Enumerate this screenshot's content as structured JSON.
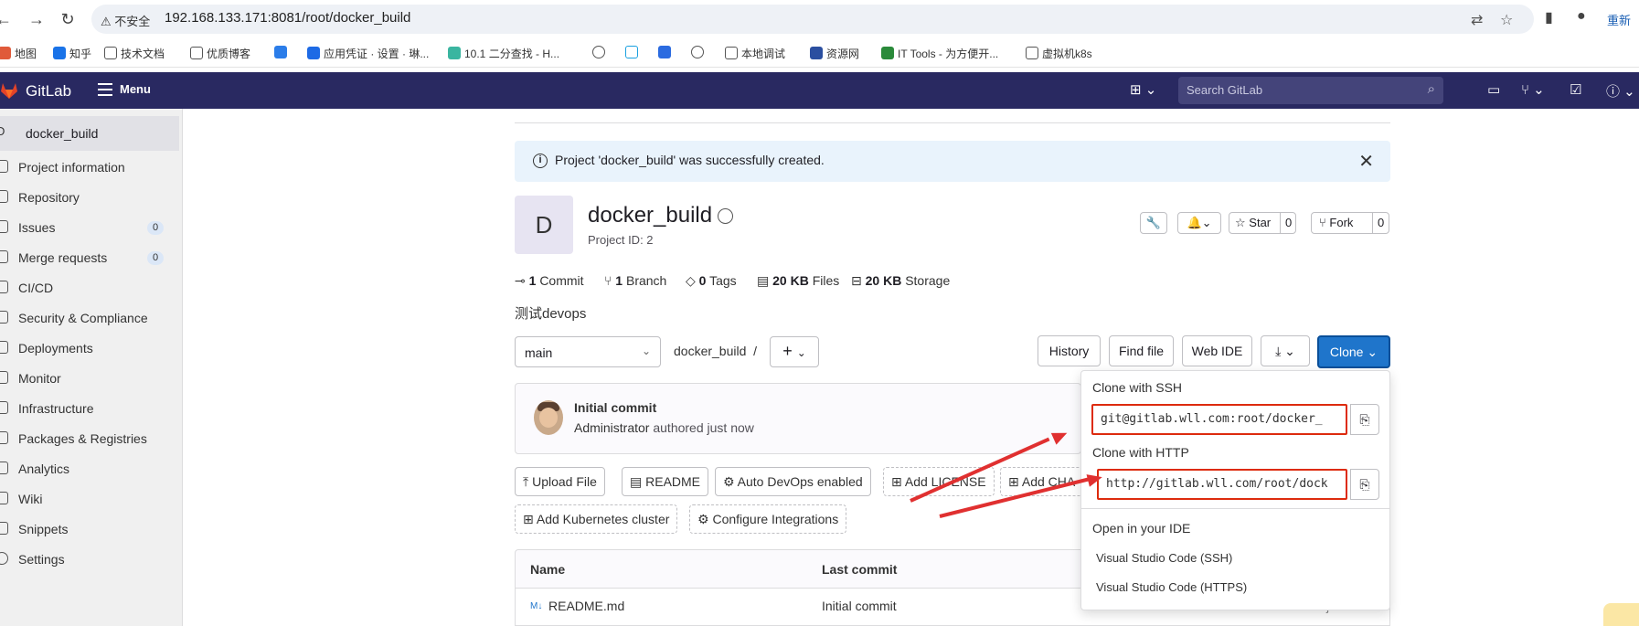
{
  "browser": {
    "insecure_label": "不安全",
    "url": "192.168.133.171:8081/root/docker_build",
    "right_text": "重新",
    "bookmarks": [
      "地图",
      "知乎",
      "技术文档",
      "优质博客",
      "应用凭证 · 设置 · 琳...",
      "10.1   二分查找 - H...",
      "本地调试",
      "资源网",
      "IT Tools - 为方便开...",
      "虚拟机k8s"
    ]
  },
  "header": {
    "brand": "GitLab",
    "menu_label": "Menu",
    "search_placeholder": "Search GitLab"
  },
  "sidebar": {
    "project_initial": "D",
    "project_name": "docker_build",
    "items": [
      {
        "label": "Project information"
      },
      {
        "label": "Repository"
      },
      {
        "label": "Issues",
        "count": "0"
      },
      {
        "label": "Merge requests",
        "count": "0"
      },
      {
        "label": "CI/CD"
      },
      {
        "label": "Security & Compliance"
      },
      {
        "label": "Deployments"
      },
      {
        "label": "Monitor"
      },
      {
        "label": "Infrastructure"
      },
      {
        "label": "Packages & Registries"
      },
      {
        "label": "Analytics"
      },
      {
        "label": "Wiki"
      },
      {
        "label": "Snippets"
      },
      {
        "label": "Settings"
      }
    ]
  },
  "alert": {
    "text": "Project 'docker_build' was successfully created."
  },
  "project": {
    "initial": "D",
    "name": "docker_build",
    "id_text": "Project ID: 2",
    "star_label": "Star",
    "star_count": "0",
    "fork_label": "Fork",
    "fork_count": "0",
    "description": "测试devops"
  },
  "stats": {
    "commits_num": "1",
    "commits_label": "Commit",
    "branches_num": "1",
    "branches_label": "Branch",
    "tags_num": "0",
    "tags_label": "Tags",
    "files_num": "20 KB",
    "files_label": "Files",
    "storage_num": "20 KB",
    "storage_label": "Storage"
  },
  "repo_bar": {
    "branch": "main",
    "path": "docker_build",
    "path_sep": "/",
    "history": "History",
    "find_file": "Find file",
    "web_ide": "Web IDE",
    "clone": "Clone"
  },
  "commit": {
    "title": "Initial commit",
    "author": "Administrator",
    "meta": "authored just now"
  },
  "actions": {
    "upload": "Upload File",
    "readme": "README",
    "autodevops": "Auto DevOps enabled",
    "license": "Add LICENSE",
    "changelog": "Add CHA",
    "kubernetes": "Add Kubernetes cluster",
    "integrations": "Configure Integrations"
  },
  "table": {
    "col_name": "Name",
    "col_commit": "Last commit",
    "rows": [
      {
        "name": "README.md",
        "commit": "Initial commit",
        "time": "just now"
      }
    ]
  },
  "clone_dropdown": {
    "ssh_heading": "Clone with SSH",
    "ssh_url": "git@gitlab.wll.com:root/docker_",
    "http_heading": "Clone with HTTP",
    "http_url": "http://gitlab.wll.com/root/dock",
    "ide_heading": "Open in your IDE",
    "ide_options": [
      "Visual Studio Code (SSH)",
      "Visual Studio Code (HTTPS)"
    ]
  },
  "colors": {
    "header_bg": "#292961",
    "clone_blue": "#1f75cb",
    "highlight_red": "#dd2b0e"
  }
}
